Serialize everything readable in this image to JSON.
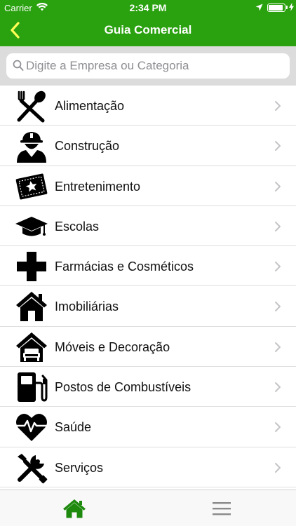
{
  "status": {
    "carrier": "Carrier",
    "time": "2:34 PM"
  },
  "header": {
    "title": "Guia Comercial",
    "back_icon": "chevron-left-icon"
  },
  "search": {
    "placeholder": "Digite a Empresa ou Categoria",
    "value": ""
  },
  "categories": [
    {
      "label": "Alimentação",
      "icon": "fork-spoon-icon"
    },
    {
      "label": "Construção",
      "icon": "construction-worker-icon"
    },
    {
      "label": "Entretenimento",
      "icon": "ticket-icon"
    },
    {
      "label": "Escolas",
      "icon": "graduation-cap-icon"
    },
    {
      "label": "Farmácias e Cosméticos",
      "icon": "medical-cross-icon"
    },
    {
      "label": "Imobiliárias",
      "icon": "house-icon"
    },
    {
      "label": "Móveis e Decoração",
      "icon": "furniture-house-icon"
    },
    {
      "label": "Postos de Combustíveis",
      "icon": "fuel-pump-icon"
    },
    {
      "label": "Saúde",
      "icon": "heartbeat-icon"
    },
    {
      "label": "Serviços",
      "icon": "tools-icon"
    }
  ],
  "tabbar": {
    "home_icon": "home-icon",
    "menu_icon": "hamburger-menu-icon"
  },
  "colors": {
    "header": "#2aa10f",
    "accent": "#2aa10f",
    "search_bg": "#dcdcdc"
  }
}
